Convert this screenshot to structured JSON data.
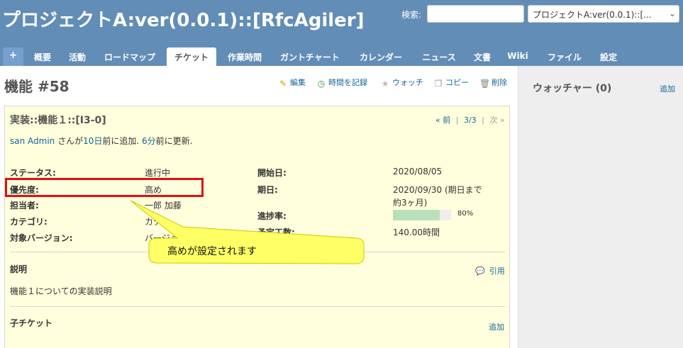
{
  "header": {
    "title": "プロジェクトA:ver(0.0.1)::[RfcAgiler]",
    "search_label": "検索:",
    "search_value": "",
    "project_select": "プロジェクトA:ver(0.0.1)::[..."
  },
  "tabs": [
    {
      "label": "+"
    },
    {
      "label": "概要"
    },
    {
      "label": "活動"
    },
    {
      "label": "ロードマップ"
    },
    {
      "label": "チケット"
    },
    {
      "label": "作業時間"
    },
    {
      "label": "ガントチャート"
    },
    {
      "label": "カレンダー"
    },
    {
      "label": "ニュース"
    },
    {
      "label": "文書"
    },
    {
      "label": "Wiki"
    },
    {
      "label": "ファイル"
    },
    {
      "label": "設定"
    }
  ],
  "issue": {
    "title": "機能 #58",
    "actions": {
      "edit": "編集",
      "log_time": "時間を記録",
      "watch": "ウォッチ",
      "copy": "コピー",
      "delete": "削除"
    },
    "subject": "実装::機能１::[I3-0]",
    "nav": {
      "prev": "« 前",
      "sep1": "|",
      "position": "3/3",
      "sep2": "|",
      "next": "次 »"
    },
    "author": {
      "name": "san Admin",
      "mid1": " さんが",
      "added": "10日",
      "mid2": "前に追加. ",
      "updated": "6分",
      "mid3": "前に更新."
    },
    "attributes": {
      "status_label": "ステータス:",
      "status_value": "進行中",
      "priority_label": "優先度:",
      "priority_value": "高め",
      "assignee_label": "担当者:",
      "assignee_value": "一郎 加藤",
      "category_label": "カテゴリ:",
      "category_value": "カテ",
      "version_label": "対象バージョン:",
      "version_value": "バージョ",
      "start_label": "開始日:",
      "start_value": "2020/08/05",
      "due_label": "期日:",
      "due_value_line1": "2020/09/30 (期日まで",
      "due_value_line2": "約3ヶ月)",
      "progress_label": "進捗率:",
      "progress_value": "80%",
      "progress_fraction": 0.8,
      "estimate_label": "予定工数:",
      "estimate_value": "140.00時間"
    },
    "description_title": "説明",
    "quote": "引用",
    "description_text": "機能１についての実装説明",
    "subtasks_title": "子チケット",
    "subtasks_add": "追加"
  },
  "sidebar": {
    "watchers_title": "ウォッチャー (0)",
    "watchers_add": "追加"
  },
  "annotation": {
    "callout_text": "高めが設定されます",
    "highlight_color": "#e01010",
    "callout_color": "#ffff66"
  }
}
